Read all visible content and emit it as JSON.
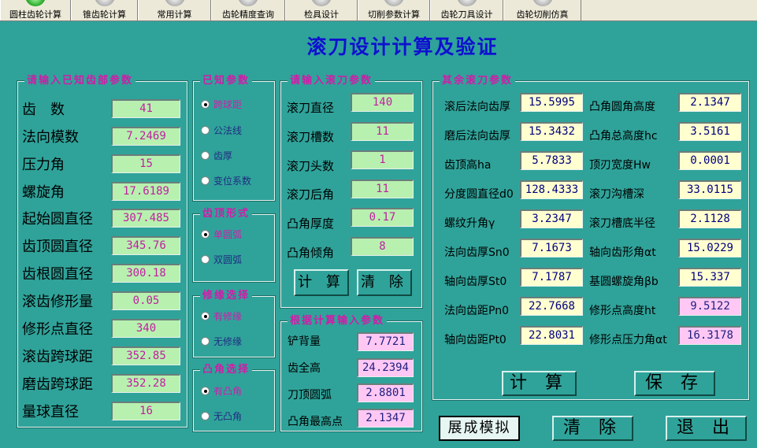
{
  "toolbar": {
    "tabs": [
      {
        "label": "圆柱齿轮计算",
        "icon": "gear-green-icon"
      },
      {
        "label": "锥齿轮计算",
        "icon": "gear-icon"
      },
      {
        "label": "常用计算",
        "icon": "gear-icon"
      },
      {
        "label": "齿轮精度查询",
        "icon": "gear-icon"
      },
      {
        "label": "检具设计",
        "icon": "gear-icon"
      },
      {
        "label": "切削参数计算",
        "icon": "gear-icon"
      },
      {
        "label": "齿轮刀具设计",
        "icon": "gear-icon"
      },
      {
        "label": "齿轮切削仿真",
        "icon": "gear-icon"
      }
    ]
  },
  "page_title": "滚刀设计计算及验证",
  "known_params": {
    "legend": "请输入已知齿部参数",
    "rows": [
      {
        "label": "齿　数",
        "value": "41"
      },
      {
        "label": "法向模数",
        "value": "7.2469"
      },
      {
        "label": "压力角",
        "value": "15"
      },
      {
        "label": "螺旋角",
        "value": "17.6189"
      },
      {
        "label": "起始圆直径",
        "value": "307.485"
      },
      {
        "label": "齿顶圆直径",
        "value": "345.76"
      },
      {
        "label": "齿根圆直径",
        "value": "300.18"
      },
      {
        "label": "滚齿修形量",
        "value": "0.05"
      },
      {
        "label": "修形点直径",
        "value": "340"
      },
      {
        "label": "滚齿跨球距",
        "value": "352.85"
      },
      {
        "label": "磨齿跨球距",
        "value": "352.28"
      },
      {
        "label": "量球直径",
        "value": "16"
      }
    ]
  },
  "known_mode": {
    "legend": "已知参数",
    "options": [
      {
        "label": "跨球距",
        "selected": true
      },
      {
        "label": "公法线",
        "selected": false
      },
      {
        "label": "齿厚",
        "selected": false
      },
      {
        "label": "变位系数",
        "selected": false
      }
    ]
  },
  "tip_form": {
    "legend": "齿顶形式",
    "options": [
      {
        "label": "单圆弧",
        "selected": true
      },
      {
        "label": "双圆弧",
        "selected": false
      }
    ]
  },
  "relief": {
    "legend": "修缘选择",
    "options": [
      {
        "label": "有修缘",
        "selected": true
      },
      {
        "label": "无修缘",
        "selected": false
      }
    ]
  },
  "bump": {
    "legend": "凸角选择",
    "options": [
      {
        "label": "有凸角",
        "selected": true
      },
      {
        "label": "无凸角",
        "selected": false
      }
    ]
  },
  "hob_params": {
    "legend": "请输入滚刀参数",
    "rows": [
      {
        "label": "滚刀直径",
        "value": "140"
      },
      {
        "label": "滚刀槽数",
        "value": "11"
      },
      {
        "label": "滚刀头数",
        "value": "1"
      },
      {
        "label": "滚刀后角",
        "value": "11"
      },
      {
        "label": "凸角厚度",
        "value": "0.17"
      },
      {
        "label": "凸角倾角",
        "value": "8"
      }
    ],
    "calc_label": "计 算",
    "clear_label": "清 除"
  },
  "computed_input": {
    "legend": "根据计算输入参数",
    "rows": [
      {
        "label": "铲背量",
        "value": "7.7721"
      },
      {
        "label": "齿全高",
        "value": "24.2394"
      },
      {
        "label": "刀顶圆弧",
        "value": "2.8801"
      },
      {
        "label": "凸角最高点",
        "value": "2.1347"
      }
    ]
  },
  "other_params": {
    "legend": "其余滚刀参数",
    "left": [
      {
        "label": "滚后法向齿厚",
        "value": "15.5995"
      },
      {
        "label": "磨后法向齿厚",
        "value": "15.3432"
      },
      {
        "label": "齿顶高ha",
        "value": "5.7833"
      },
      {
        "label": "分度圆直径d0",
        "value": "128.4333"
      },
      {
        "label": "螺纹升角γ",
        "value": "3.2347"
      },
      {
        "label": "法向齿厚Sn0",
        "value": "7.1673"
      },
      {
        "label": "轴向齿厚St0",
        "value": "7.1787"
      },
      {
        "label": "法向齿距Pn0",
        "value": "22.7668"
      },
      {
        "label": "轴向齿距Pt0",
        "value": "22.8031"
      }
    ],
    "right": [
      {
        "label": "凸角圆角高度",
        "value": "2.1347",
        "pink": false
      },
      {
        "label": "凸角总高度hc",
        "value": "3.5161",
        "pink": false
      },
      {
        "label": "顶刃宽度Hw",
        "value": "0.0001",
        "pink": false
      },
      {
        "label": "滚刀沟槽深",
        "value": "33.0115",
        "pink": false
      },
      {
        "label": "滚刀槽底半径",
        "value": "2.1128",
        "pink": false
      },
      {
        "label": "轴向齿形角αt",
        "value": "15.0229",
        "pink": false
      },
      {
        "label": "基圆螺旋角βb",
        "value": "15.337",
        "pink": false
      },
      {
        "label": "修形点高度ht",
        "value": "9.5122",
        "pink": true
      },
      {
        "label": "修形点压力角αt",
        "value": "16.3178",
        "pink": true
      }
    ],
    "calc_label": "计 算",
    "save_label": "保 存"
  },
  "bottom": {
    "simulate_label": "展成模拟",
    "clear_label": "清 除",
    "exit_label": "退 出"
  }
}
